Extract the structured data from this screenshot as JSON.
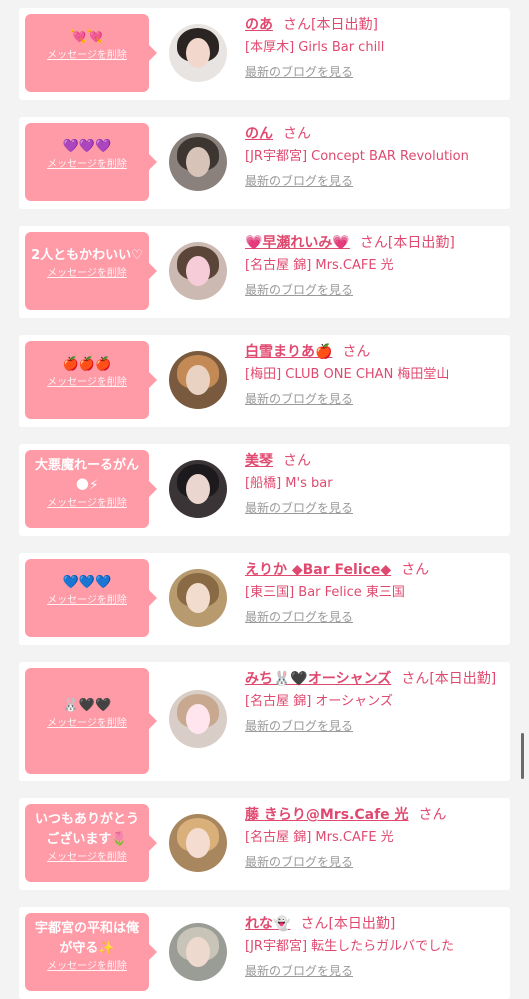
{
  "common": {
    "delete_label": "メッセージを削除",
    "blog_label": "最新のブログを見る",
    "honorific": "さん"
  },
  "colors": {
    "accent": "#e0496f",
    "bubble": "#ff9aa7",
    "link_gray": "#9a9a9a",
    "card_bg": "#ffffff",
    "page_bg": "#f3f3f3"
  },
  "items": [
    {
      "message": "💘💘",
      "name": "のあ",
      "status": "[本日出勤]",
      "shop": "[本厚木] Girls Bar chill",
      "avatar_icon": "avatar-photo"
    },
    {
      "message": "💜💜💜",
      "name": "のん",
      "status": "",
      "shop": "[JR宇都宮] Concept BAR Revolution",
      "avatar_icon": "avatar-photo"
    },
    {
      "message": "2人ともかわいい♡",
      "name": "💗早瀬れいみ💗",
      "status": "[本日出勤]",
      "shop": "[名古屋 錦] Mrs.CAFE 光",
      "avatar_icon": "avatar-photo"
    },
    {
      "message": "🍎🍎🍎",
      "name": "白雪まりあ🍎",
      "status": "",
      "shop": "[梅田] CLUB ONE CHAN 梅田堂山",
      "avatar_icon": "avatar-photo"
    },
    {
      "message": "大悪魔れーるがん🌑⚡",
      "name": "美琴",
      "status": "",
      "shop": "[船橋] M's bar",
      "avatar_icon": "avatar-photo"
    },
    {
      "message": "💙💙💙",
      "name": "えりか ◆Bar Felice◆",
      "status": "",
      "shop": "[東三国] Bar Felice 東三国",
      "avatar_icon": "avatar-photo"
    },
    {
      "message": "🐰🖤🖤",
      "name": "みち🐰🖤オーシャンズ",
      "status": "[本日出勤]",
      "shop": "[名古屋 錦] オーシャンズ",
      "avatar_icon": "avatar-photo"
    },
    {
      "message": "いつもありがとうございます🌷",
      "name": "藤 きらり@Mrs.Cafe 光",
      "status": "",
      "shop": "[名古屋 錦] Mrs.CAFE 光",
      "avatar_icon": "avatar-photo"
    },
    {
      "message": "宇都宮の平和は俺が守る✨",
      "name": "れな👻",
      "status": "[本日出勤]",
      "shop": "[JR宇都宮] 転生したらガルバでした",
      "avatar_icon": "avatar-photo"
    }
  ]
}
